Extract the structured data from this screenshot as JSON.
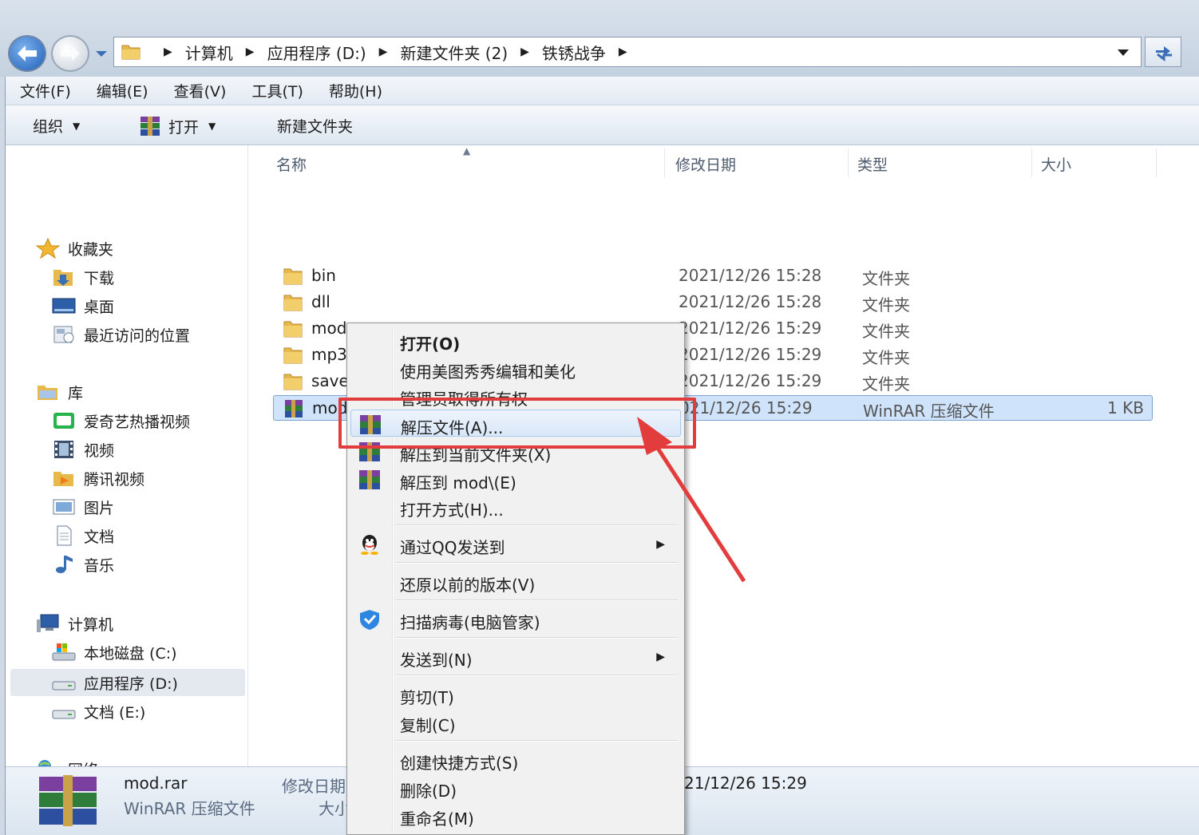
{
  "address_bar": {
    "crumbs": [
      "计算机",
      "应用程序 (D:)",
      "新建文件夹 (2)",
      "铁锈战争"
    ]
  },
  "menubar": {
    "items": [
      "文件(F)",
      "编辑(E)",
      "查看(V)",
      "工具(T)",
      "帮助(H)"
    ]
  },
  "toolbar": {
    "organize": "组织",
    "open": "打开",
    "new_folder": "新建文件夹"
  },
  "sidebar": {
    "favorites": "收藏夹",
    "fav_items": [
      "下载",
      "桌面",
      "最近访问的位置"
    ],
    "libraries": "库",
    "lib_items": [
      "爱奇艺热播视频",
      "视频",
      "腾讯视频",
      "图片",
      "文档",
      "音乐"
    ],
    "computer": "计算机",
    "computer_items": [
      "本地磁盘 (C:)",
      "应用程序 (D:)",
      "文档 (E:)"
    ],
    "network": "网络",
    "selected": "应用程序 (D:)"
  },
  "columns": {
    "name": "名称",
    "modified": "修改日期",
    "type": "类型",
    "size": "大小"
  },
  "files": [
    {
      "name": "bin",
      "date": "2021/12/26 15:28",
      "type": "文件夹",
      "size": ""
    },
    {
      "name": "dll",
      "date": "2021/12/26 15:28",
      "type": "文件夹",
      "size": ""
    },
    {
      "name": "mod",
      "date": "2021/12/26 15:29",
      "type": "文件夹",
      "size": ""
    },
    {
      "name": "mp3",
      "date": "2021/12/26 15:29",
      "type": "文件夹",
      "size": ""
    },
    {
      "name": "save",
      "date": "2021/12/26 15:29",
      "type": "文件夹",
      "size": ""
    },
    {
      "name": "mod",
      "date": "021/12/26 15:29",
      "type": "WinRAR 压缩文件",
      "size": "1 KB"
    }
  ],
  "details": {
    "filename": "mod.rar",
    "filetype": "WinRAR 压缩文件",
    "modified_label": "修改日期",
    "modified_value": "21/12/26 15:29",
    "size_label": "大小"
  },
  "context_menu": {
    "items": [
      {
        "label": "打开(O)",
        "bold": true
      },
      {
        "label": "使用美图秀秀编辑和美化"
      },
      {
        "label": "管理员取得所有权"
      },
      {
        "label": "解压文件(A)..."
      },
      {
        "label": "解压到当前文件夹(X)"
      },
      {
        "label": "解压到 mod\\(E)"
      },
      {
        "label": "打开方式(H)..."
      },
      {
        "label": "通过QQ发送到"
      },
      {
        "label": "还原以前的版本(V)"
      },
      {
        "label": "扫描病毒(电脑管家)"
      },
      {
        "label": "发送到(N)"
      },
      {
        "label": "剪切(T)"
      },
      {
        "label": "复制(C)"
      },
      {
        "label": "创建快捷方式(S)"
      },
      {
        "label": "删除(D)"
      },
      {
        "label": "重命名(M)"
      }
    ],
    "highlighted": "解压文件(A)..."
  },
  "colors": {
    "annotation": "#e23c3c",
    "selection": "#cfe3fb",
    "folder": "#e7b94a"
  }
}
